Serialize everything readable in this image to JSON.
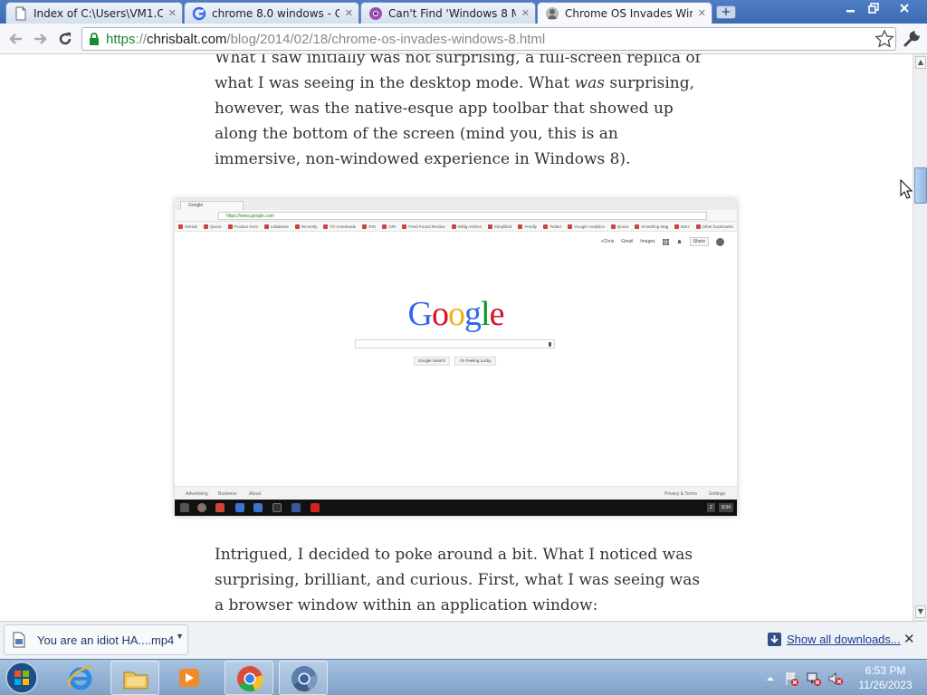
{
  "tabs": [
    {
      "title": "Index of C:\\Users\\VM1.C...",
      "favicon": "page-icon",
      "active": false
    },
    {
      "title": "chrome 8.0 windows - G...",
      "favicon": "google-g-icon",
      "active": false
    },
    {
      "title": "Can't Find 'Windows 8 M...",
      "favicon": "chrome-logo-icon",
      "active": false
    },
    {
      "title": "Chrome OS Invades Win...",
      "favicon": "avatar-icon",
      "active": true
    }
  ],
  "toolbar": {
    "url_scheme": "https",
    "url_sep": "://",
    "url_host": "chrisbalt.com",
    "url_path": "/blog/2014/02/18/chrome-os-invades-windows-8.html"
  },
  "article": {
    "para1_a": "What I saw initially was not surprising, a full-screen replica of what I was seeing in the desktop mode. What ",
    "para1_em": "was",
    "para1_b": " surprising, however, was the native-esque app toolbar that showed up along the bottom of the screen (mind you, this is an immersive, non-windowed experience in Windows 8).",
    "para2": "Intrigued, I decided to poke around a bit. What I noticed was surprising, brilliant, and curious. First, what I was seeing was a browser window within an application window:"
  },
  "screenshot": {
    "tab_title": "Google",
    "url": "https://www.google.com",
    "bookmarks": [
      "GitHub",
      "Quora",
      "Product Hunt",
      "collabwire",
      "Recently",
      "TD Ameritrade",
      "RIG",
      "GRI",
      "Feed Found Review",
      "Wfdg Articles",
      "Simplified",
      "Feedly",
      "Twitter",
      "Google Analytics",
      "Quora",
      "Smashing Mag",
      "BSU",
      "Other bookmarks"
    ],
    "top_links": [
      "+Chris",
      "Gmail",
      "Images"
    ],
    "share": "Share",
    "logo_letters": [
      {
        "ch": "G",
        "color": "#3369e8"
      },
      {
        "ch": "o",
        "color": "#d50f25"
      },
      {
        "ch": "o",
        "color": "#eeb211"
      },
      {
        "ch": "g",
        "color": "#3369e8"
      },
      {
        "ch": "l",
        "color": "#009925"
      },
      {
        "ch": "e",
        "color": "#d50f25"
      }
    ],
    "search_button": "Google Search",
    "lucky_button": "I'm Feeling Lucky",
    "footer_left": [
      "Advertising",
      "Business",
      "About"
    ],
    "footer_right": [
      "Privacy & Terms",
      "Settings"
    ],
    "shelf_badge": "2",
    "shelf_clock": "8:34"
  },
  "downloads": {
    "item_name": "You are an idiot HA....mp4",
    "show_all": "Show all downloads..."
  },
  "taskbar": {
    "time": "6:53 PM",
    "date": "11/26/2023"
  },
  "colors": {
    "accent": "#3a6ab3",
    "link": "#1a3d8f",
    "https_green": "#1a8a2e"
  }
}
